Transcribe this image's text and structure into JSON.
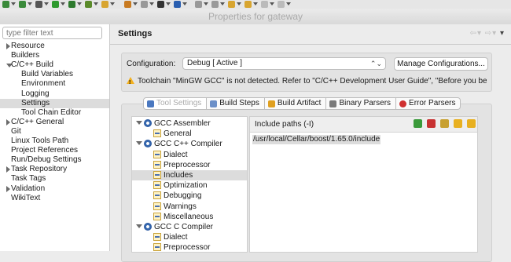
{
  "window": {
    "title": "Properties for gateway"
  },
  "toolbar": {
    "icons": [
      "bug-icon",
      "run-icon",
      "settings-icon",
      "play-icon",
      "external-tools-icon",
      "tools-icon",
      "folder-icon",
      "pen-icon",
      "build-icon",
      "user-icon",
      "monitor-icon",
      "pin-icon",
      "down-icon",
      "up-icon",
      "next-icon",
      "back-icon",
      "forward-icon"
    ]
  },
  "sidebar": {
    "filter_placeholder": "type filter text",
    "items": [
      {
        "label": "Resource",
        "level": 0,
        "toggle": "collapsed",
        "selected": false
      },
      {
        "label": "Builders",
        "level": 0,
        "toggle": "none",
        "selected": false
      },
      {
        "label": "C/C++ Build",
        "level": 0,
        "toggle": "expanded",
        "selected": false
      },
      {
        "label": "Build Variables",
        "level": 1,
        "toggle": "none",
        "selected": false
      },
      {
        "label": "Environment",
        "level": 1,
        "toggle": "none",
        "selected": false
      },
      {
        "label": "Logging",
        "level": 1,
        "toggle": "none",
        "selected": false
      },
      {
        "label": "Settings",
        "level": 1,
        "toggle": "none",
        "selected": true
      },
      {
        "label": "Tool Chain Editor",
        "level": 1,
        "toggle": "none",
        "selected": false
      },
      {
        "label": "C/C++ General",
        "level": 0,
        "toggle": "collapsed",
        "selected": false
      },
      {
        "label": "Git",
        "level": 0,
        "toggle": "none",
        "selected": false
      },
      {
        "label": "Linux Tools Path",
        "level": 0,
        "toggle": "none",
        "selected": false
      },
      {
        "label": "Project References",
        "level": 0,
        "toggle": "none",
        "selected": false
      },
      {
        "label": "Run/Debug Settings",
        "level": 0,
        "toggle": "none",
        "selected": false
      },
      {
        "label": "Task Repository",
        "level": 0,
        "toggle": "collapsed",
        "selected": false
      },
      {
        "label": "Task Tags",
        "level": 0,
        "toggle": "none",
        "selected": false
      },
      {
        "label": "Validation",
        "level": 0,
        "toggle": "collapsed",
        "selected": false
      },
      {
        "label": "WikiText",
        "level": 0,
        "toggle": "none",
        "selected": false
      }
    ]
  },
  "main": {
    "title": "Settings",
    "configuration": {
      "label": "Configuration:",
      "value": "Debug  [ Active ]",
      "manage_label": "Manage Configurations..."
    },
    "warning": "Toolchain \"MinGW GCC\" is not detected. Refer to \"C/C++ Development User Guide\", \"Before you begin\" how",
    "tabs": [
      {
        "label": "Tool Settings",
        "active": true,
        "icon": "tool-settings-icon",
        "color": "#4a78c0"
      },
      {
        "label": "Build Steps",
        "active": false,
        "icon": "build-steps-icon",
        "color": "#6b8fc8"
      },
      {
        "label": "Build Artifact",
        "active": false,
        "icon": "build-artifact-icon",
        "color": "#e0a020"
      },
      {
        "label": "Binary Parsers",
        "active": false,
        "icon": "binary-parsers-icon",
        "color": "#7a7a7a"
      },
      {
        "label": "Error Parsers",
        "active": false,
        "icon": "error-parsers-icon",
        "color": "#d03030"
      }
    ],
    "tool_tree": [
      {
        "label": "GCC Assembler",
        "level": 0,
        "kind": "tool",
        "selected": false
      },
      {
        "label": "General",
        "level": 1,
        "kind": "option",
        "selected": false
      },
      {
        "label": "GCC C++ Compiler",
        "level": 0,
        "kind": "tool",
        "selected": false
      },
      {
        "label": "Dialect",
        "level": 1,
        "kind": "option",
        "selected": false
      },
      {
        "label": "Preprocessor",
        "level": 1,
        "kind": "option",
        "selected": false
      },
      {
        "label": "Includes",
        "level": 1,
        "kind": "option",
        "selected": true
      },
      {
        "label": "Optimization",
        "level": 1,
        "kind": "option",
        "selected": false
      },
      {
        "label": "Debugging",
        "level": 1,
        "kind": "option",
        "selected": false
      },
      {
        "label": "Warnings",
        "level": 1,
        "kind": "option",
        "selected": false
      },
      {
        "label": "Miscellaneous",
        "level": 1,
        "kind": "option",
        "selected": false
      },
      {
        "label": "GCC C Compiler",
        "level": 0,
        "kind": "tool",
        "selected": false
      },
      {
        "label": "Dialect",
        "level": 1,
        "kind": "option",
        "selected": false
      },
      {
        "label": "Preprocessor",
        "level": 1,
        "kind": "option",
        "selected": false
      }
    ],
    "include_paths": {
      "title": "Include paths (-I)",
      "buttons": [
        {
          "name": "add-path-icon",
          "color": "#3a9a3a"
        },
        {
          "name": "delete-path-icon",
          "color": "#c83232"
        },
        {
          "name": "edit-path-icon",
          "color": "#c8a030"
        },
        {
          "name": "move-up-icon",
          "color": "#e8b020"
        },
        {
          "name": "move-down-icon",
          "color": "#e8b020"
        }
      ],
      "entries": [
        "/usr/local/Cellar/boost/1.65.0/include"
      ]
    }
  }
}
